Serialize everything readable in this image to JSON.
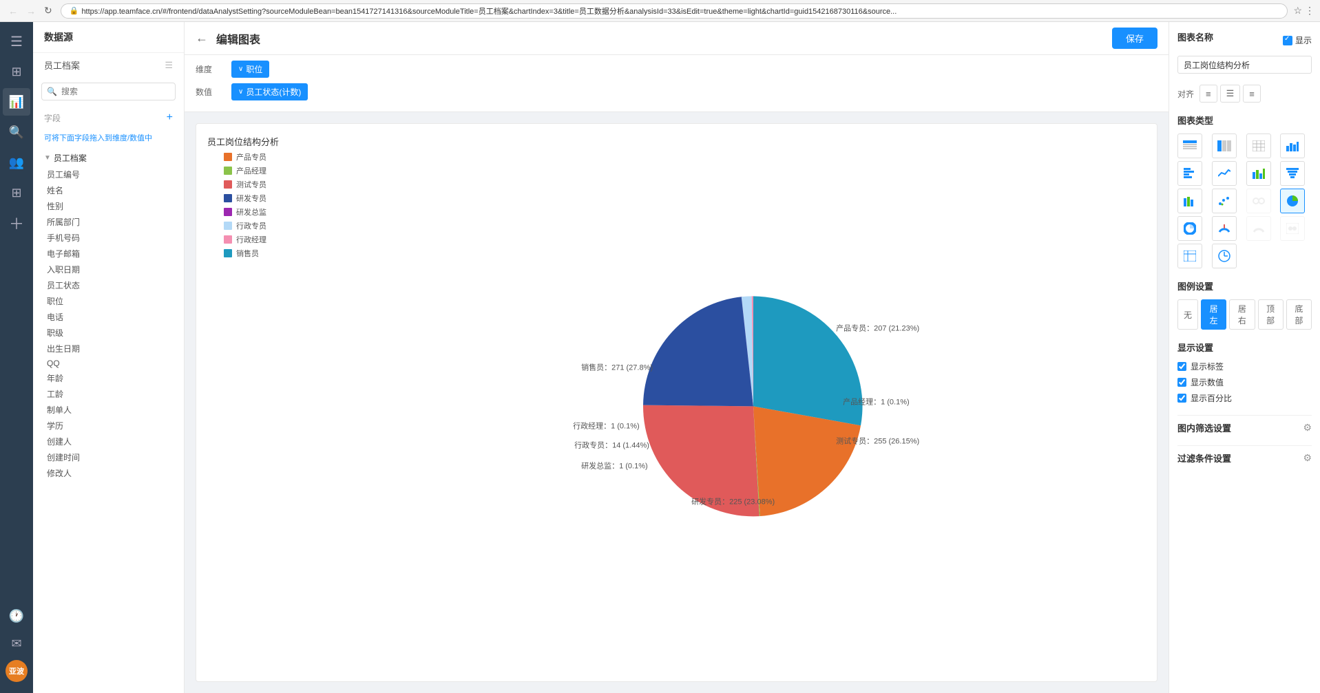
{
  "browser": {
    "url": "https://app.teamface.cn/#/frontend/dataAnalystSetting?sourceModuleBean=bean1541727141316&sourceModuleTitle=员工档案&chartIndex=3&title=员工数据分析&analysisId=33&isEdit=true&theme=light&chartId=guid1542168730116&source...",
    "secure_label": "安全"
  },
  "header": {
    "back_title": "编辑图表",
    "save_label": "保存"
  },
  "data_panel": {
    "title": "数据源",
    "source_name": "员工档案",
    "search_placeholder": "搜索",
    "fields_label": "字段",
    "add_icon": "+",
    "hint": "可将下面字段拖入到维度/数值中",
    "tree": {
      "parent": "员工档案",
      "items": [
        "员工编号",
        "姓名",
        "性别",
        "所属部门",
        "手机号码",
        "电子邮箱",
        "入职日期",
        "员工状态",
        "职位",
        "电话",
        "职级",
        "出生日期",
        "QQ",
        "年龄",
        "工龄",
        "制单人",
        "学历",
        "创建人",
        "创建时间",
        "修改人"
      ]
    }
  },
  "dimension": {
    "label": "维度",
    "tag": "职位",
    "chevron": "∨"
  },
  "value": {
    "label": "数值",
    "tag": "员工状态(计数)",
    "chevron": "∨"
  },
  "chart": {
    "title": "员工岗位结构分析",
    "legend": [
      {
        "label": "产品专员",
        "color": "#e8712a"
      },
      {
        "label": "产品经理",
        "color": "#8bc34a"
      },
      {
        "label": "测试专员",
        "color": "#e05a5a"
      },
      {
        "label": "研发专员",
        "color": "#2b4fa0"
      },
      {
        "label": "研发总监",
        "color": "#9c27b0"
      },
      {
        "label": "行政专员",
        "color": "#b3d9f7"
      },
      {
        "label": "行政经理",
        "color": "#f48fb1"
      },
      {
        "label": "销售员",
        "color": "#1e9abf"
      }
    ],
    "segments": [
      {
        "label": "产品专员: 207 (21.23%)",
        "value": 207,
        "pct": 21.23,
        "color": "#e8712a"
      },
      {
        "label": "产品经理: 1 (0.1%)",
        "value": 1,
        "pct": 0.1,
        "color": "#8bc34a"
      },
      {
        "label": "测试专员: 255 (26.15%)",
        "value": 255,
        "pct": 26.15,
        "color": "#e05a5a"
      },
      {
        "label": "研发专员: 225 (23.08%)",
        "value": 225,
        "pct": 23.08,
        "color": "#2b4fa0"
      },
      {
        "label": "研发总监: 1 (0.1%)",
        "value": 1,
        "pct": 0.1,
        "color": "#9c27b0"
      },
      {
        "label": "行政专员: 14 (1.44%)",
        "value": 14,
        "pct": 1.44,
        "color": "#b3d9f7"
      },
      {
        "label": "行政经理: 1 (0.1%)",
        "value": 1,
        "pct": 0.1,
        "color": "#f48fb1"
      },
      {
        "label": "销售员: 271 (27.8%)",
        "value": 271,
        "pct": 27.8,
        "color": "#1e9abf"
      }
    ],
    "label_positions": [
      {
        "text": "产品专员：207 (21.23%)",
        "x": "64%",
        "y": "28%"
      },
      {
        "text": "产品经理：1 (0.1%)",
        "x": "68%",
        "y": "49%"
      },
      {
        "text": "测试专员：255 (26.15%)",
        "x": "66%",
        "y": "62%"
      },
      {
        "text": "研发专员：225 (23.08%)",
        "x": "38%",
        "y": "79%"
      },
      {
        "text": "研发总监：1 (0.1%)",
        "x": "26%",
        "y": "66%"
      },
      {
        "text": "行政专员：14 (1.44%)",
        "x": "25%",
        "y": "59%"
      },
      {
        "text": "行政经理：1 (0.1%)",
        "x": "26%",
        "y": "53%"
      },
      {
        "text": "销售员：271 (27.8%)",
        "x": "29%",
        "y": "38%"
      }
    ]
  },
  "right_panel": {
    "chart_name_section": {
      "title": "图表名称",
      "show_label": "显示",
      "name_value": "员工岗位结构分析"
    },
    "align_label": "对齐",
    "align_options": [
      "left",
      "center",
      "right"
    ],
    "chart_type_section": {
      "title": "图表类型"
    },
    "chart_types": [
      {
        "icon": "⊞",
        "name": "table1",
        "active": false
      },
      {
        "icon": "⊟",
        "name": "table2",
        "active": false
      },
      {
        "icon": "▦",
        "name": "table3",
        "active": false
      },
      {
        "icon": "📊",
        "name": "bar-vertical",
        "active": false
      },
      {
        "icon": "📉",
        "name": "bar-horizontal",
        "active": false
      },
      {
        "icon": "📈",
        "name": "line",
        "active": false
      },
      {
        "icon": "📊",
        "name": "bar2",
        "active": false
      },
      {
        "icon": "═",
        "name": "funnel",
        "active": false
      },
      {
        "icon": "📊",
        "name": "bar3",
        "active": false
      },
      {
        "icon": "⋯",
        "name": "scatter",
        "active": false
      },
      {
        "icon": "⋮",
        "name": "dot",
        "active": false
      },
      {
        "icon": "●",
        "name": "pie",
        "active": true
      },
      {
        "icon": "◉",
        "name": "donut",
        "active": false
      },
      {
        "icon": "◔",
        "name": "gauge1",
        "active": false
      },
      {
        "icon": "◑",
        "name": "gauge2",
        "active": false
      },
      {
        "icon": "▧",
        "name": "table4",
        "active": false
      },
      {
        "icon": "⊙",
        "name": "clock",
        "active": false
      }
    ],
    "legend_section": {
      "title": "图例设置"
    },
    "legend_positions": [
      "无",
      "居左",
      "居右",
      "顶部",
      "底部"
    ],
    "legend_active": "居左",
    "display_section": {
      "title": "显示设置"
    },
    "display_items": [
      {
        "label": "显示标签",
        "checked": true
      },
      {
        "label": "显示数值",
        "checked": true
      },
      {
        "label": "显示百分比",
        "checked": true
      }
    ],
    "filter_section": "图内筛选设置",
    "condition_section": "过滤条件设置"
  },
  "sidebar_icons": [
    {
      "icon": "☰",
      "name": "menu"
    },
    {
      "icon": "⊞",
      "name": "dashboard"
    },
    {
      "icon": "🔍",
      "name": "search"
    },
    {
      "icon": "👥",
      "name": "users"
    },
    {
      "icon": "⚙",
      "name": "apps"
    },
    {
      "icon": "＋",
      "name": "add"
    },
    {
      "icon": "🕐",
      "name": "history"
    },
    {
      "icon": "✉",
      "name": "mail"
    }
  ],
  "user": {
    "avatar_text": "亚波"
  }
}
